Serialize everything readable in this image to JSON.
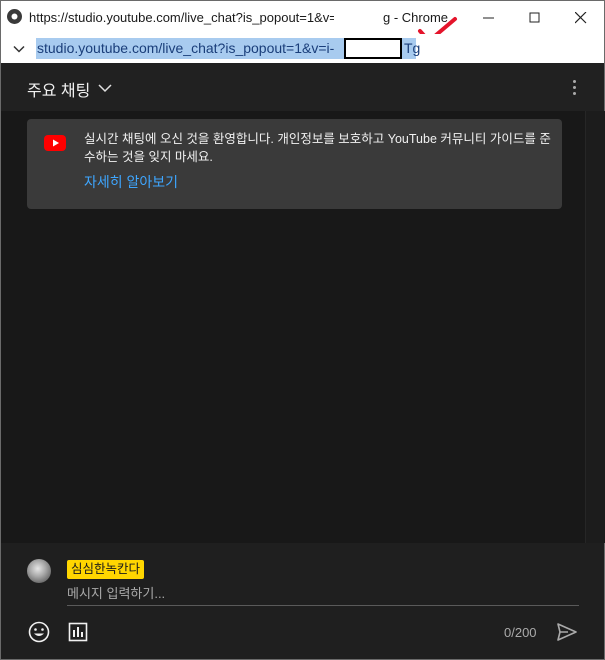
{
  "window": {
    "title_visible_start": "https://studio.youtube.com/live_chat?is_popout=1&v=i-h",
    "title_visible_end": "g - Chrome",
    "annotation_icon": "red-checkmark-icon"
  },
  "address_bar": {
    "url_start": "studio.youtube.com/live_chat?is_popout=1&v=i-",
    "url_end": "Tg",
    "dropdown_icon": "chevron-down-icon"
  },
  "chat_header": {
    "title": "주요 채팅",
    "menu_icon": "more-vert-icon"
  },
  "welcome_card": {
    "logo_icon": "youtube-logo-icon",
    "message": "실시간 채팅에 오신 것을 환영합니다. 개인정보를 보호하고 YouTube 커뮤니티 가이드를 준수하는 것을 잊지 마세요.",
    "link_text": "자세히 알아보기"
  },
  "composer": {
    "username": "심심한녹칸다",
    "placeholder": "메시지 입력하기...",
    "char_count": "0/200",
    "emoji_icon": "emoji-icon",
    "poll_icon": "poll-icon",
    "send_icon": "send-icon"
  },
  "colors": {
    "link": "#3ea6ff",
    "username_badge": "#ffd600",
    "youtube_red": "#ff0000",
    "background": "#0f0f0f"
  }
}
